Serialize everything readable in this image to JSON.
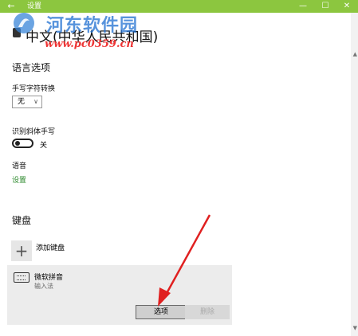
{
  "window": {
    "title": "设置",
    "back_glyph": "←",
    "minimize_glyph": "—",
    "maximize_glyph": "☐",
    "close_glyph": "✕"
  },
  "watermark": {
    "site_name": "河东软件园",
    "url": "www.pc0359.cn"
  },
  "page": {
    "title": "中文(中华人民共和国)"
  },
  "language_options": {
    "section_title": "语言选项",
    "handwriting_label": "手写字符转换",
    "handwriting_value": "无",
    "italic_label": "识别斜体手写",
    "italic_state": "关",
    "speech_label": "语音",
    "speech_link": "设置"
  },
  "keyboard": {
    "section_title": "键盘",
    "add_label": "添加键盘",
    "add_glyph": "+",
    "items": [
      {
        "name": "微软拼音",
        "subtitle": "输入法"
      }
    ],
    "options_button": "选项",
    "delete_button": "删除"
  },
  "colors": {
    "titlebar": "#8cc63f",
    "link": "#2d8a2d",
    "arrow": "#e02020"
  }
}
